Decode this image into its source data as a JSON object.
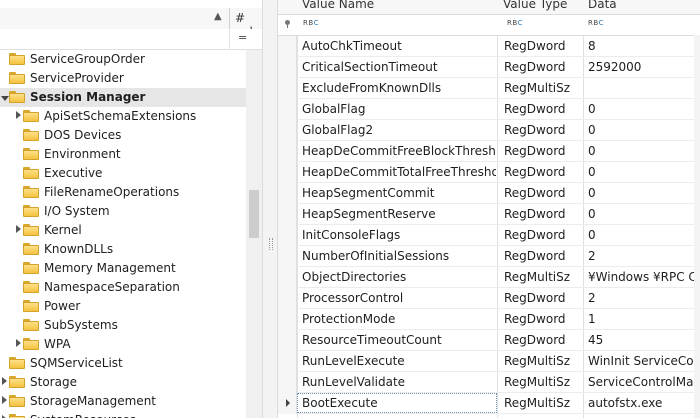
{
  "tree": {
    "column_header_value": "# val",
    "filter_symbol": "=",
    "items": [
      {
        "label": "ServiceGroupOrder",
        "level": 0,
        "expander": "none",
        "bold": false,
        "selected": false
      },
      {
        "label": "ServiceProvider",
        "level": 0,
        "expander": "none",
        "bold": false,
        "selected": false
      },
      {
        "label": "Session Manager",
        "level": 0,
        "expander": "expanded",
        "bold": true,
        "selected": true
      },
      {
        "label": "ApiSetSchemaExtensions",
        "level": 1,
        "expander": "collapsed",
        "bold": false,
        "selected": false
      },
      {
        "label": "DOS Devices",
        "level": 1,
        "expander": "none",
        "bold": false,
        "selected": false
      },
      {
        "label": "Environment",
        "level": 1,
        "expander": "none",
        "bold": false,
        "selected": false
      },
      {
        "label": "Executive",
        "level": 1,
        "expander": "none",
        "bold": false,
        "selected": false
      },
      {
        "label": "FileRenameOperations",
        "level": 1,
        "expander": "none",
        "bold": false,
        "selected": false
      },
      {
        "label": "I/O System",
        "level": 1,
        "expander": "none",
        "bold": false,
        "selected": false
      },
      {
        "label": "Kernel",
        "level": 1,
        "expander": "collapsed",
        "bold": false,
        "selected": false
      },
      {
        "label": "KnownDLLs",
        "level": 1,
        "expander": "none",
        "bold": false,
        "selected": false
      },
      {
        "label": "Memory Management",
        "level": 1,
        "expander": "none",
        "bold": false,
        "selected": false
      },
      {
        "label": "NamespaceSeparation",
        "level": 1,
        "expander": "none",
        "bold": false,
        "selected": false
      },
      {
        "label": "Power",
        "level": 1,
        "expander": "none",
        "bold": false,
        "selected": false
      },
      {
        "label": "SubSystems",
        "level": 1,
        "expander": "none",
        "bold": false,
        "selected": false
      },
      {
        "label": "WPA",
        "level": 1,
        "expander": "collapsed",
        "bold": false,
        "selected": false
      },
      {
        "label": "SQMServiceList",
        "level": 0,
        "expander": "none",
        "bold": false,
        "selected": false
      },
      {
        "label": "Storage",
        "level": 0,
        "expander": "collapsed",
        "bold": false,
        "selected": false
      },
      {
        "label": "StorageManagement",
        "level": 0,
        "expander": "collapsed",
        "bold": false,
        "selected": false
      },
      {
        "label": "SystemResources",
        "level": 0,
        "expander": "collapsed",
        "bold": false,
        "selected": false
      }
    ]
  },
  "grid": {
    "headers": {
      "name": "Value Name",
      "type": "Value Type",
      "data": "Data"
    },
    "filter_icon_text": {
      "a": "R",
      "b": "B",
      "c": "C"
    },
    "rows": [
      {
        "name": "AutoChkTimeout",
        "type": "RegDword",
        "data": "8"
      },
      {
        "name": "CriticalSectionTimeout",
        "type": "RegDword",
        "data": "2592000"
      },
      {
        "name": "ExcludeFromKnownDlls",
        "type": "RegMultiSz",
        "data": ""
      },
      {
        "name": "GlobalFlag",
        "type": "RegDword",
        "data": "0"
      },
      {
        "name": "GlobalFlag2",
        "type": "RegDword",
        "data": "0"
      },
      {
        "name": "HeapDeCommitFreeBlockThreshold",
        "type": "RegDword",
        "data": "0"
      },
      {
        "name": "HeapDeCommitTotalFreeThreshold",
        "type": "RegDword",
        "data": "0"
      },
      {
        "name": "HeapSegmentCommit",
        "type": "RegDword",
        "data": "0"
      },
      {
        "name": "HeapSegmentReserve",
        "type": "RegDword",
        "data": "0"
      },
      {
        "name": "InitConsoleFlags",
        "type": "RegDword",
        "data": "0"
      },
      {
        "name": "NumberOfInitialSessions",
        "type": "RegDword",
        "data": "2"
      },
      {
        "name": "ObjectDirectories",
        "type": "RegMultiSz",
        "data": "¥Windows ¥RPC C..."
      },
      {
        "name": "ProcessorControl",
        "type": "RegDword",
        "data": "2"
      },
      {
        "name": "ProtectionMode",
        "type": "RegDword",
        "data": "1"
      },
      {
        "name": "ResourceTimeoutCount",
        "type": "RegDword",
        "data": "45"
      },
      {
        "name": "RunLevelExecute",
        "type": "RegMultiSz",
        "data": "WinInit ServiceCo..."
      },
      {
        "name": "RunLevelValidate",
        "type": "RegMultiSz",
        "data": "ServiceControlMa..."
      },
      {
        "name": "BootExecute",
        "type": "RegMultiSz",
        "data": "autofstx.exe",
        "selected": true
      }
    ]
  },
  "colors": {
    "folder": "#f3c33f",
    "selection": "#e6e6e6",
    "accent": "#2a7ab8"
  }
}
